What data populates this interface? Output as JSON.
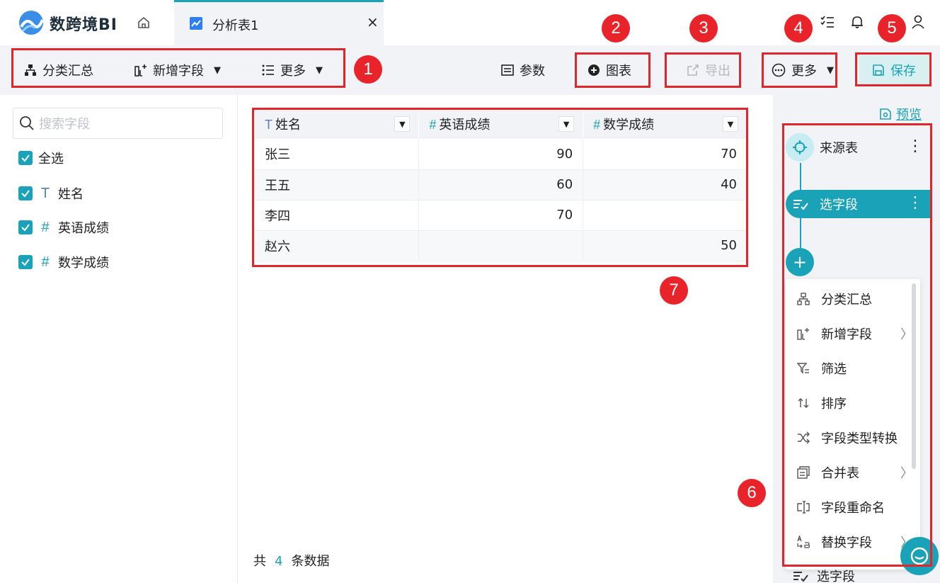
{
  "app": {
    "name": "数跨境BI"
  },
  "tab": {
    "label": "分析表1",
    "close": "×"
  },
  "toolbar": {
    "group_summary": "分类汇总",
    "add_field": "新增字段",
    "more_left": "更多",
    "params": "参数",
    "chart": "图表",
    "export": "导出",
    "more_right": "更多",
    "save": "保存"
  },
  "markers": [
    "1",
    "2",
    "3",
    "4",
    "5",
    "6",
    "7"
  ],
  "left": {
    "search_placeholder": "搜索字段",
    "select_all": "全选",
    "fields": [
      {
        "type": "T",
        "name": "姓名"
      },
      {
        "type": "#",
        "name": "英语成绩"
      },
      {
        "type": "#",
        "name": "数学成绩"
      }
    ]
  },
  "table": {
    "columns": [
      {
        "type": "T",
        "name": "姓名"
      },
      {
        "type": "#",
        "name": "英语成绩"
      },
      {
        "type": "#",
        "name": "数学成绩"
      }
    ],
    "rows": [
      [
        "张三",
        "90",
        "70"
      ],
      [
        "王五",
        "60",
        "40"
      ],
      [
        "李四",
        "70",
        ""
      ],
      [
        "赵六",
        "",
        "50"
      ]
    ]
  },
  "footer": {
    "prefix": "共",
    "count": "4",
    "suffix": "条数据"
  },
  "right": {
    "preview": "预览",
    "step_source": "来源表",
    "step_select": "选字段",
    "plus": "+",
    "menu": [
      {
        "label": "分类汇总",
        "icon": "hierarchy-icon",
        "sub": false
      },
      {
        "label": "新增字段",
        "icon": "add-column-icon",
        "sub": true
      },
      {
        "label": "筛选",
        "icon": "filter-icon",
        "sub": false
      },
      {
        "label": "排序",
        "icon": "sort-icon",
        "sub": false
      },
      {
        "label": "字段类型转换",
        "icon": "shuffle-icon",
        "sub": false
      },
      {
        "label": "合并表",
        "icon": "merge-icon",
        "sub": true
      },
      {
        "label": "字段重命名",
        "icon": "rename-icon",
        "sub": false
      },
      {
        "label": "替换字段",
        "icon": "replace-icon",
        "sub": true
      }
    ],
    "bottom_step": "选字段"
  },
  "colors": {
    "accent": "#1aa3b8",
    "annotation": "#e8232a"
  }
}
